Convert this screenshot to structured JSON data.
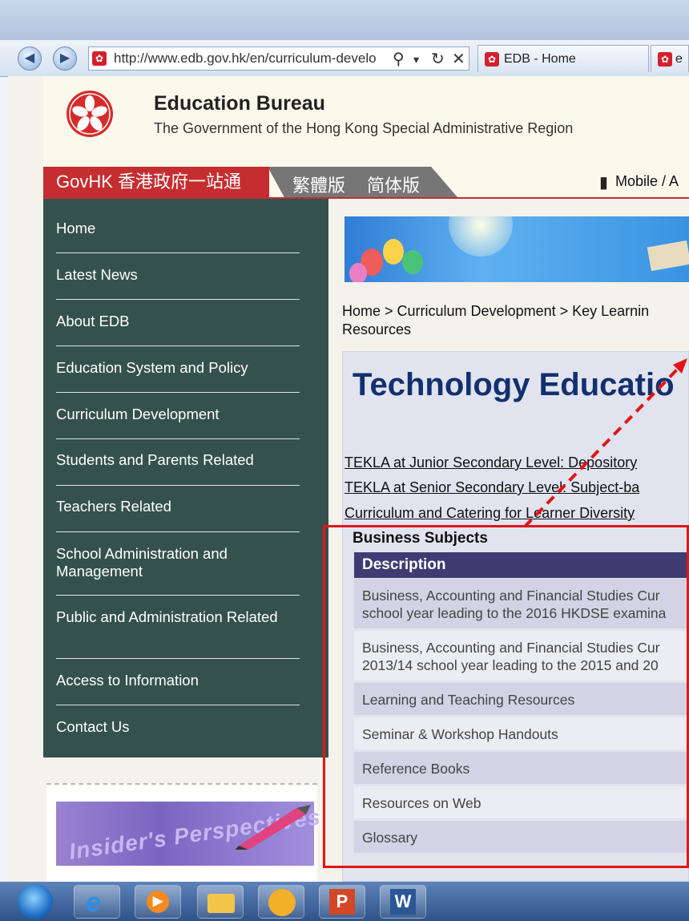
{
  "browser": {
    "url": "http://www.edb.gov.hk/en/curriculum-develo",
    "tabs": [
      {
        "label": "EDB - Home"
      },
      {
        "label": "e"
      }
    ]
  },
  "site": {
    "title": "Education Bureau",
    "subtitle": "The Government of the Hong Kong Special Administrative Region",
    "govhk": "GovHK 香港政府一站通",
    "lang_traditional": "繁體版",
    "lang_simplified": "简体版",
    "mobile_link": "Mobile / A"
  },
  "nav": {
    "items": [
      {
        "label": "Home"
      },
      {
        "label": "Latest News"
      },
      {
        "label": "About EDB"
      },
      {
        "label": "Education System and Policy"
      },
      {
        "label": "Curriculum Development"
      },
      {
        "label": "Students and Parents Related"
      },
      {
        "label": "Teachers Related"
      },
      {
        "label": "School Administration and Management"
      },
      {
        "label": "Public and Administration Related"
      },
      {
        "label": "Access to Information"
      },
      {
        "label": "Contact Us"
      }
    ]
  },
  "insider": {
    "text": "Insider's Perspectives"
  },
  "breadcrumb": {
    "home": "Home",
    "sep": " > ",
    "curriculum": "Curriculum Development",
    "kla": "Key Learnin",
    "resources": "Resources"
  },
  "main": {
    "title": "Technology Educatio",
    "links": [
      {
        "label": "TEKLA at Junior Secondary Level: Depository"
      },
      {
        "label": "TEKLA at Senior Secondary Level: Subject-ba"
      },
      {
        "label": "Curriculum and Catering for Learner Diversity"
      }
    ],
    "section_heading": "Business Subjects",
    "table_header": "Description",
    "rows": [
      {
        "line1": "Business, Accounting and Financial Studies Cur",
        "line2": "school year leading to the 2016 HKDSE examina"
      },
      {
        "line1": "Business, Accounting and Financial Studies Cur",
        "line2": "2013/14 school year leading to the 2015 and 20"
      },
      {
        "line1": "Learning and Teaching Resources"
      },
      {
        "line1": "Seminar & Workshop Handouts"
      },
      {
        "line1": "Reference Books"
      },
      {
        "line1": "Resources on Web"
      },
      {
        "line1": "Glossary"
      }
    ]
  },
  "colors": {
    "nav_bg": "#34514d",
    "govhk_red": "#c62d30",
    "title_blue": "#13306e",
    "table_header_bg": "#3f3c73",
    "annotation_red": "#e21515"
  },
  "taskbar": {
    "apps": [
      "start-orb",
      "internet-explorer",
      "media-player",
      "file-explorer",
      "app-yellow",
      "powerpoint",
      "word"
    ]
  }
}
